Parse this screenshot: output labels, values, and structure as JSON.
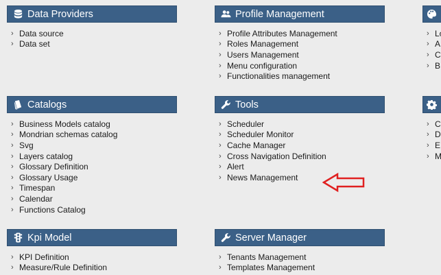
{
  "panels": {
    "data_providers": {
      "title": "Data Providers",
      "icon": "database-icon",
      "items": [
        "Data source",
        "Data set"
      ]
    },
    "profile_management": {
      "title": "Profile Management",
      "icon": "users-icon",
      "items": [
        "Profile Attributes Management",
        "Roles Management",
        "Users Management",
        "Menu configuration",
        "Functionalities management"
      ]
    },
    "partial_top": {
      "icon": "palette-icon",
      "items": [
        "Lo",
        "A",
        "C",
        "B"
      ]
    },
    "catalogs": {
      "title": "Catalogs",
      "icon": "book-icon",
      "items": [
        "Business Models catalog",
        "Mondrian schemas catalog",
        "Svg",
        "Layers catalog",
        "Glossary Definition",
        "Glossary Usage",
        "Timespan",
        "Calendar",
        "Functions Catalog"
      ]
    },
    "tools": {
      "title": "Tools",
      "icon": "wrench-icon",
      "items": [
        "Scheduler",
        "Scheduler Monitor",
        "Cache Manager",
        "Cross Navigation Definition",
        "Alert",
        "News Management"
      ]
    },
    "partial_mid": {
      "icon": "gear-icon",
      "items": [
        "C",
        "D",
        "E",
        "M"
      ]
    },
    "kpi_model": {
      "title": "Kpi Model",
      "icon": "traffic-light-icon",
      "items": [
        "KPI Definition",
        "Measure/Rule Definition"
      ]
    },
    "server_manager": {
      "title": "Server Manager",
      "icon": "wrench-icon",
      "items": [
        "Tenants Management",
        "Templates Management"
      ]
    }
  },
  "annotation": {
    "arrow_color": "#e02020",
    "points_to": "News Management"
  },
  "colors": {
    "header_bg": "#3b6087",
    "page_bg": "#ececec"
  }
}
